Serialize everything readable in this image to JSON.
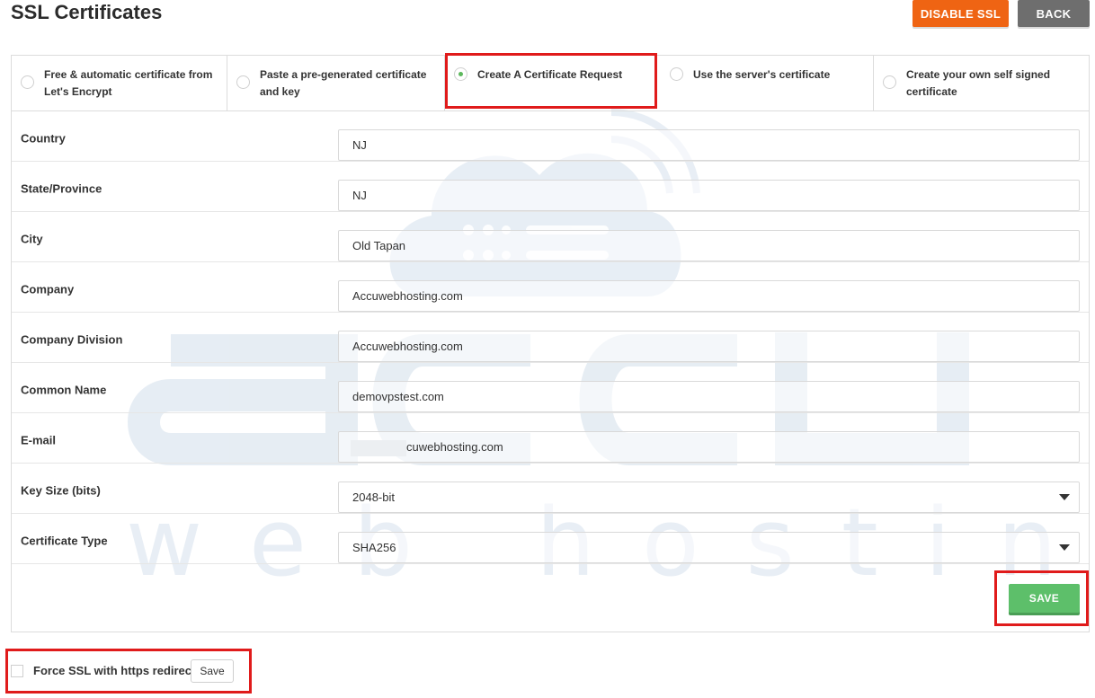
{
  "header": {
    "title": "SSL Certificates",
    "disable_ssl_label": "DISABLE SSL",
    "back_label": "BACK"
  },
  "tabs": [
    {
      "label": "Free & automatic certificate from Let's Encrypt",
      "selected": false
    },
    {
      "label": "Paste a pre-generated certificate and key",
      "selected": false
    },
    {
      "label": "Create A Certificate Request",
      "selected": true
    },
    {
      "label": "Use the server's certificate",
      "selected": false
    },
    {
      "label": "Create your own self signed certificate",
      "selected": false
    }
  ],
  "form": {
    "country": {
      "label": "Country",
      "value": "NJ"
    },
    "state": {
      "label": "State/Province",
      "value": "NJ"
    },
    "city": {
      "label": "City",
      "value": "Old Tapan"
    },
    "company": {
      "label": "Company",
      "value": "Accuwebhosting.com"
    },
    "division": {
      "label": "Company Division",
      "value": "Accuwebhosting.com"
    },
    "common_name": {
      "label": "Common Name",
      "value": "demovpstest.com"
    },
    "email": {
      "label": "E-mail",
      "value": "cuwebhosting.com"
    },
    "key_size": {
      "label": "Key Size (bits)",
      "value": "2048-bit"
    },
    "cert_type": {
      "label": "Certificate Type",
      "value": "SHA256"
    }
  },
  "save_label": "SAVE",
  "force_ssl": {
    "label": "Force SSL with https redirect",
    "save_label": "Save",
    "checked": false
  },
  "colors": {
    "orange": "#ef6413",
    "gray": "#6e6e6e",
    "green": "#5dbf6a",
    "highlight": "#e01b1b"
  },
  "watermark": {
    "brand_line": "accu",
    "sub_line": "web hosting"
  }
}
